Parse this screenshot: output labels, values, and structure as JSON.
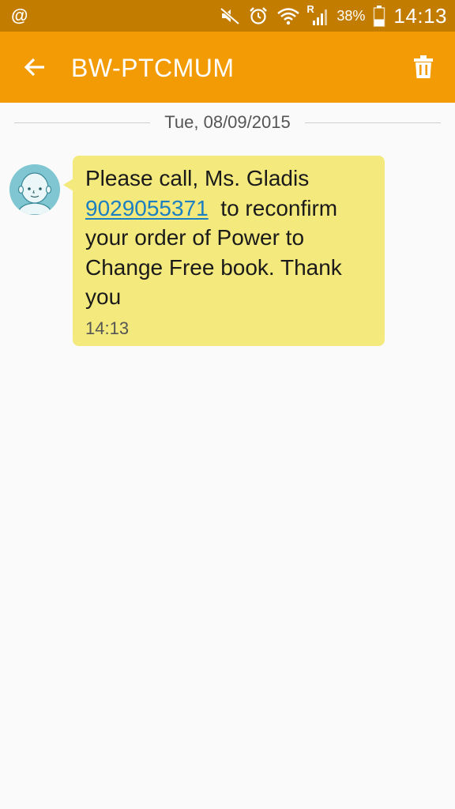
{
  "status_bar": {
    "left_icon": "@",
    "icons": [
      "mute-icon",
      "alarm-icon",
      "wifi-icon",
      "roaming-signal-icon",
      "battery-icon"
    ],
    "roaming_label": "R",
    "battery_percent": "38%",
    "battery_level": 0.38,
    "time": "14:13",
    "background_color": "#c27c00"
  },
  "app_bar": {
    "title": "BW-PTCMUM",
    "back_icon": "arrow-left-icon",
    "delete_icon": "trash-icon",
    "background_color": "#f29b05"
  },
  "conversation": {
    "date_divider": "Tue, 08/09/2015",
    "messages": [
      {
        "text_before": "Please call, Ms. Gladis ",
        "phone": "9029055371",
        "text_after": "  to reconfirm your order of Power to Change Free book. Thank you",
        "time": "14:13",
        "bubble_color": "#f3e97c",
        "link_color": "#1b7fc2"
      }
    ]
  }
}
